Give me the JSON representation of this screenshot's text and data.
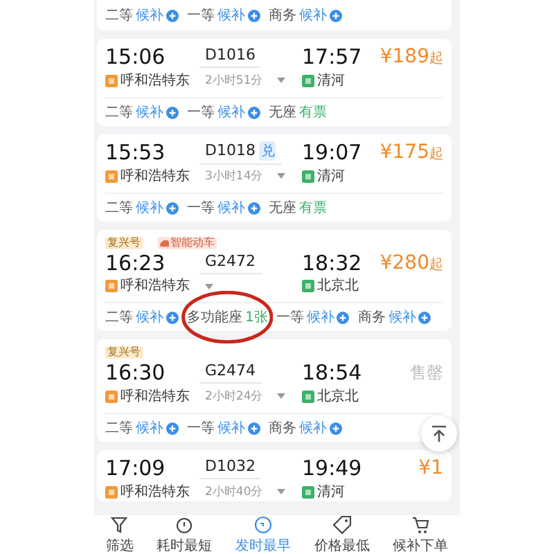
{
  "top_seats": [
    {
      "class": "二等",
      "status": "候补",
      "kind": "waitlist"
    },
    {
      "class": "一等",
      "status": "候补",
      "kind": "waitlist"
    },
    {
      "class": "商务",
      "status": "候补",
      "kind": "waitlist"
    }
  ],
  "trains": [
    {
      "depart_time": "15:06",
      "train_no": "D1016",
      "arrive_time": "17:57",
      "price": {
        "kind": "fare",
        "text": "¥189",
        "suffix": "起"
      },
      "from": "呼和浩特东",
      "duration": "2小时51分",
      "to": "清河",
      "seats": [
        {
          "class": "二等",
          "status": "候补",
          "kind": "waitlist"
        },
        {
          "class": "一等",
          "status": "候补",
          "kind": "waitlist"
        },
        {
          "class": "无座",
          "status": "有票",
          "kind": "available"
        }
      ]
    },
    {
      "depart_time": "15:53",
      "train_no": "D1018",
      "badge": "兑",
      "arrive_time": "19:07",
      "price": {
        "kind": "fare",
        "text": "¥175",
        "suffix": "起"
      },
      "from": "呼和浩特东",
      "duration": "3小时14分",
      "to": "清河",
      "seats": [
        {
          "class": "二等",
          "status": "候补",
          "kind": "waitlist"
        },
        {
          "class": "一等",
          "status": "候补",
          "kind": "waitlist"
        },
        {
          "class": "无座",
          "status": "有票",
          "kind": "available"
        }
      ]
    },
    {
      "tags": [
        {
          "text": "复兴号",
          "kind": "plain"
        },
        {
          "text": "智能动车",
          "kind": "smart"
        }
      ],
      "depart_time": "16:23",
      "train_no": "G2472",
      "arrive_time": "18:32",
      "price": {
        "kind": "fare",
        "text": "¥280",
        "suffix": "起"
      },
      "from": "呼和浩特东",
      "to": "北京北",
      "seats": [
        {
          "class": "二等",
          "status": "候补",
          "kind": "waitlist"
        },
        {
          "class": "多功能座",
          "status": "1张",
          "kind": "available",
          "circled": true
        },
        {
          "class": "一等",
          "status": "候补",
          "kind": "waitlist"
        },
        {
          "class": "商务",
          "status": "候补",
          "kind": "waitlist"
        }
      ]
    },
    {
      "tags": [
        {
          "text": "复兴号",
          "kind": "plain"
        }
      ],
      "depart_time": "16:30",
      "train_no": "G2474",
      "arrive_time": "18:54",
      "price": {
        "kind": "soldout",
        "text": "售罄"
      },
      "from": "呼和浩特东",
      "duration": "2小时24分",
      "to": "北京北",
      "seats": [
        {
          "class": "二等",
          "status": "候补",
          "kind": "waitlist"
        },
        {
          "class": "一等",
          "status": "候补",
          "kind": "waitlist"
        },
        {
          "class": "商务",
          "status": "候补",
          "kind": "waitlist"
        }
      ]
    },
    {
      "depart_time": "17:09",
      "train_no": "D1032",
      "arrive_time": "19:49",
      "price": {
        "kind": "fare",
        "text": "¥1"
      },
      "from": "呼和浩特东",
      "duration": "2小时40分",
      "to": "清河"
    }
  ],
  "nav": [
    {
      "label": "筛选",
      "selected": false
    },
    {
      "label": "耗时最短",
      "selected": false
    },
    {
      "label": "发时最早",
      "selected": true
    },
    {
      "label": "价格最低",
      "selected": false
    },
    {
      "label": "候补下单",
      "selected": false
    }
  ]
}
